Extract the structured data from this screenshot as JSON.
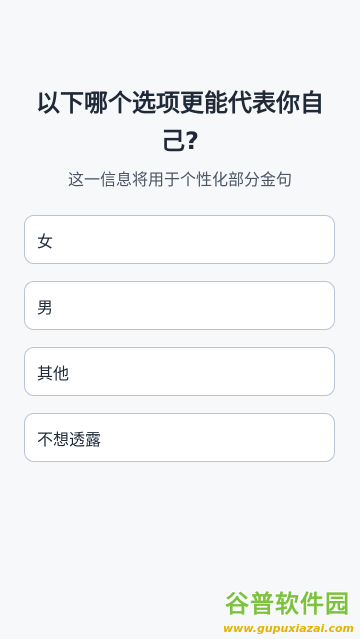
{
  "question": {
    "title": "以下哪个选项更能代表你自己?",
    "subtitle": "这一信息将用于个性化部分金句"
  },
  "options": [
    {
      "label": "女"
    },
    {
      "label": "男"
    },
    {
      "label": "其他"
    },
    {
      "label": "不想透露"
    }
  ],
  "watermark": {
    "brand": "谷普软件园",
    "url": "www.gupuxiazai.com"
  },
  "colors": {
    "background": "#f7f8fa",
    "option_border": "#bcc3d3",
    "watermark_green": "#7cc23e",
    "watermark_yellow": "#e2b400"
  }
}
